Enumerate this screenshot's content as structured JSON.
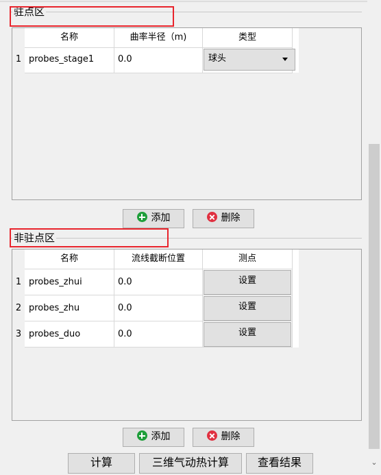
{
  "stagnation": {
    "title": "驻点区",
    "headers": [
      "名称",
      "曲率半径（m)",
      "类型"
    ],
    "rows": [
      {
        "num": "1",
        "name": "probes_stage1",
        "radius": "0.0",
        "type": "球头"
      }
    ],
    "add_label": "添加",
    "delete_label": "删除"
  },
  "non_stagnation": {
    "title": "非驻点区",
    "headers": [
      "名称",
      "流线截断位置",
      "测点"
    ],
    "rows": [
      {
        "num": "1",
        "name": "probes_zhui",
        "position": "0.0",
        "button": "设置"
      },
      {
        "num": "2",
        "name": "probes_zhu",
        "position": "0.0",
        "button": "设置"
      },
      {
        "num": "3",
        "name": "probes_duo",
        "position": "0.0",
        "button": "设置"
      }
    ],
    "add_label": "添加",
    "delete_label": "删除"
  },
  "bottom_buttons": {
    "calculate": "计算",
    "aero_heat": "三维气动热计算",
    "view_results": "查看结果"
  },
  "colors": {
    "highlight_border": "#e8232b",
    "add_icon": "#1e9e3a",
    "delete_icon": "#e03040"
  },
  "icons": {
    "add": "plus-circle-icon",
    "delete": "x-circle-icon",
    "dropdown": "caret-down-icon",
    "scroll_down": "chevron-down-icon"
  }
}
